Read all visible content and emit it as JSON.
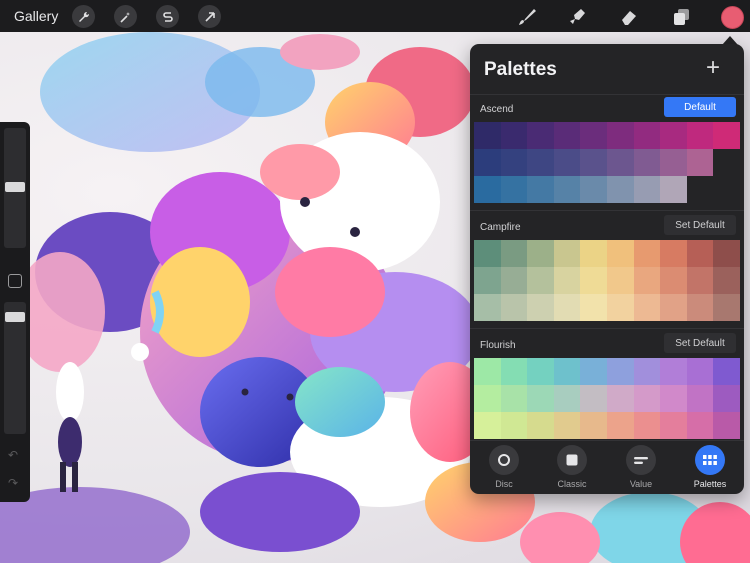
{
  "toolbar": {
    "gallery_label": "Gallery",
    "left_icons": [
      "wrench-icon",
      "magic-wand-icon",
      "selection-s-icon",
      "move-arrow-icon"
    ],
    "right_icons": [
      "brush-icon",
      "smudge-icon",
      "eraser-icon",
      "layers-icon"
    ],
    "current_color": "#e85d72"
  },
  "palettes_panel": {
    "title": "Palettes",
    "add_label": "+",
    "palettes": [
      {
        "name": "Ascend",
        "button": "Default",
        "colors": [
          [
            "#2f2a68",
            "#3a2a6e",
            "#4a2b74",
            "#5a2c78",
            "#6b2d7c",
            "#7e2c7e",
            "#922b80",
            "#a82a80",
            "#bf297e",
            "#cf2a77"
          ],
          [
            "#2c3d7c",
            "#34417f",
            "#3e4683",
            "#4b4c88",
            "#5a528c",
            "#6c568f",
            "#805b92",
            "#965f93",
            "#ad6393",
            "",
            ""
          ],
          [
            "#2a6ba0",
            "#3572a2",
            "#4479a4",
            "#5682a7",
            "#6a8aaa",
            "#8093ae",
            "#979cb2",
            "#b0a6b7",
            "",
            ""
          ]
        ]
      },
      {
        "name": "Campfire",
        "button": "Set Default",
        "colors": [
          [
            "#5d8e7a",
            "#7a9b82",
            "#9cb089",
            "#c9c68f",
            "#ebd386",
            "#f0c07c",
            "#e79a6f",
            "#d77b62",
            "#b65f56",
            "#8e4e4b"
          ],
          [
            "#7ea48f",
            "#97ad95",
            "#b4c19c",
            "#d8d3a0",
            "#efdb96",
            "#f1c88b",
            "#e9a77f",
            "#db8c72",
            "#c27468",
            "#9b615c"
          ],
          [
            "#a6bea7",
            "#b9c4aa",
            "#cdd0b0",
            "#e2dcb3",
            "#f2e2ab",
            "#f2d29f",
            "#edb993",
            "#e1a287",
            "#cb8b7b",
            "#a8786f"
          ]
        ]
      },
      {
        "name": "Flourish",
        "button": "Set Default",
        "colors": [
          [
            "#9de8a6",
            "#84ddb3",
            "#74d1c0",
            "#6ec1cc",
            "#79b0d8",
            "#8ea0dd",
            "#a18fdc",
            "#b17ed8",
            "#a86fd4",
            "#7f5ad0"
          ],
          [
            "#b4eda0",
            "#a8e2a8",
            "#9cd8b6",
            "#a8cdbf",
            "#c3bdc3",
            "#d0aac8",
            "#d49ac9",
            "#d189ca",
            "#c173c5",
            "#9d5bc0"
          ],
          [
            "#d6f09a",
            "#d0e894",
            "#d6db8e",
            "#e1cb8e",
            "#e7b98c",
            "#eca38b",
            "#eb8f8f",
            "#e47e9c",
            "#d66ea8",
            "#b95aa8"
          ]
        ]
      }
    ],
    "tabs": [
      {
        "label": "Disc",
        "icon": "disc-icon"
      },
      {
        "label": "Classic",
        "icon": "square-icon"
      },
      {
        "label": "Value",
        "icon": "value-slider-icon"
      },
      {
        "label": "Palettes",
        "icon": "palette-grid-icon",
        "active": true
      }
    ]
  }
}
